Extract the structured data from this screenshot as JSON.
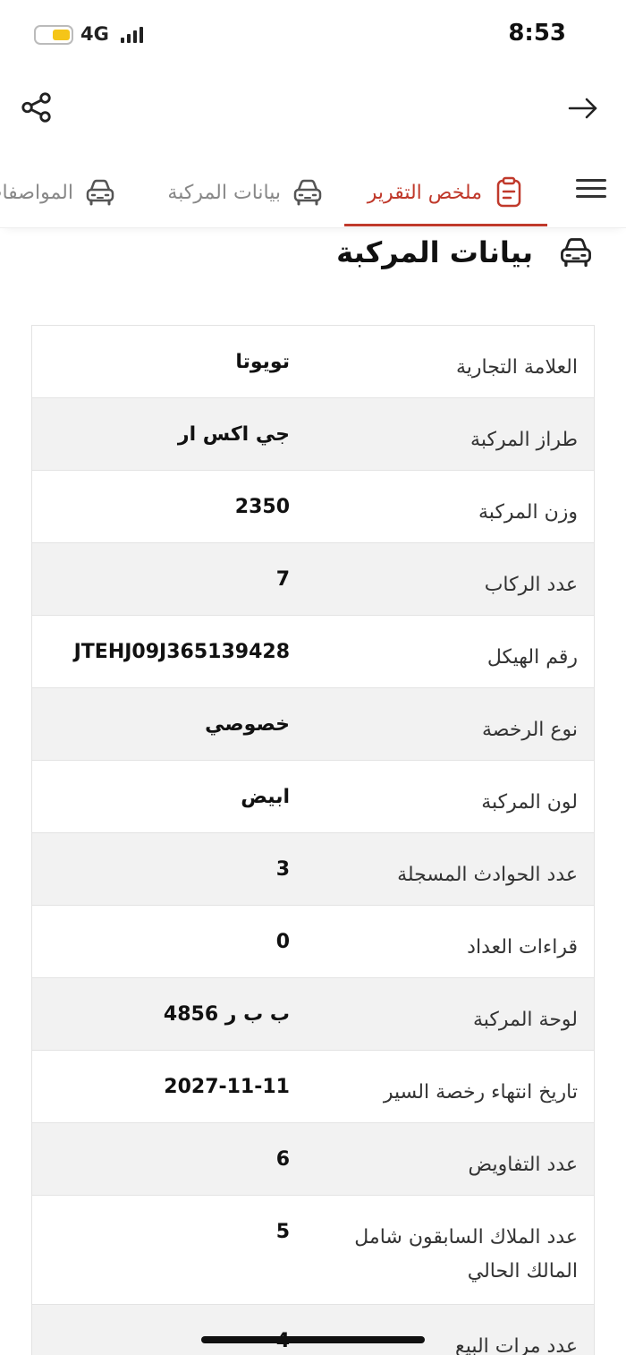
{
  "status_bar": {
    "network": "4G",
    "time": "8:53"
  },
  "tabs": [
    {
      "label": "ملخص التقرير",
      "icon": "clipboard-icon",
      "active": true
    },
    {
      "label": "بيانات المركبة",
      "icon": "car-icon",
      "active": false
    },
    {
      "label": "المواصفات",
      "icon": "car-icon",
      "active": false
    }
  ],
  "section": {
    "title": "بيانات المركبة",
    "icon": "car-icon"
  },
  "vehicle_rows": [
    {
      "label": "العلامة التجارية",
      "value": "تويوتا"
    },
    {
      "label": "طراز المركبة",
      "value": "جي اكس  ار"
    },
    {
      "label": "وزن المركبة",
      "value": "2350"
    },
    {
      "label": "عدد الركاب",
      "value": "7"
    },
    {
      "label": "رقم الهيكل",
      "value": "JTEHJ09J365139428"
    },
    {
      "label": "نوع الرخصة",
      "value": "خصوصي"
    },
    {
      "label": "لون المركبة",
      "value": "ابيض"
    },
    {
      "label": "عدد الحوادث المسجلة",
      "value": "3"
    },
    {
      "label": "قراءات العداد",
      "value": "0"
    },
    {
      "label": "لوحة المركبة",
      "value": "ب ب ر 4856"
    },
    {
      "label": "تاريخ انتهاء رخصة السير",
      "value": "2027-11-11"
    },
    {
      "label": "عدد التفاويض",
      "value": "6"
    },
    {
      "label": "عدد الملاك السابقون شامل المالك الحالي",
      "value": "5"
    },
    {
      "label": "عدد مرات البيع",
      "value": "4"
    }
  ],
  "colors": {
    "accent": "#c0392b",
    "row_alt": "#f2f2f2",
    "battery": "#f5c518"
  }
}
